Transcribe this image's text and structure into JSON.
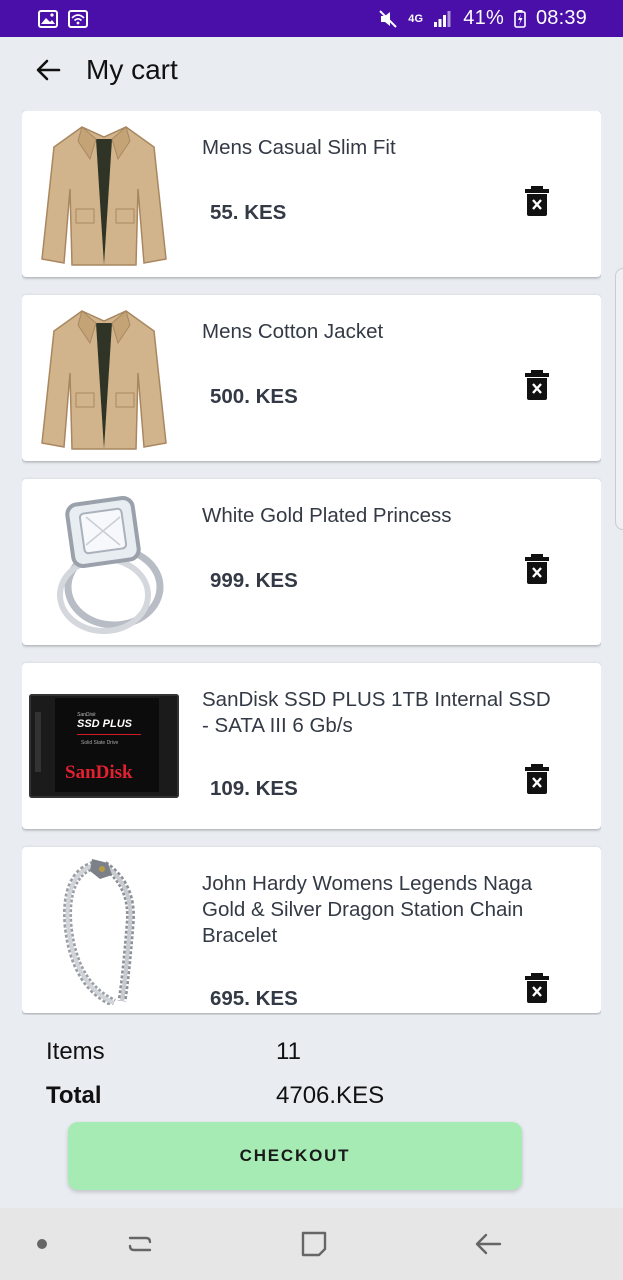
{
  "status_bar": {
    "battery": "41%",
    "time": "08:39",
    "network": "4G",
    "icons": [
      "image-icon",
      "wifi-icon",
      "mute-icon",
      "signal-icon",
      "battery-icon"
    ]
  },
  "header": {
    "title": "My cart",
    "back_icon": "arrow-left-icon"
  },
  "cart": {
    "items": [
      {
        "title": "Mens Casual Slim Fit",
        "price": "55. KES",
        "image": "jacket"
      },
      {
        "title": "Mens Cotton Jacket",
        "price": "500. KES",
        "image": "jacket"
      },
      {
        "title": "White Gold Plated Princess",
        "price": "999. KES",
        "image": "ring"
      },
      {
        "title": "SanDisk SSD PLUS 1TB Internal SSD - SATA III 6 Gb/s",
        "price": "109. KES",
        "image": "ssd"
      },
      {
        "title": "John Hardy Womens Legends Naga Gold & Silver Dragon Station Chain Bracelet",
        "price": "695. KES",
        "image": "bracelet"
      }
    ],
    "ssd_brand": "SanDisk",
    "ssd_model": "SSD PLUS",
    "ssd_sub": "Solid State Drive",
    "ssd_top": "SanDisk"
  },
  "summary": {
    "items_label": "Items",
    "items_value": "11",
    "total_label": "Total",
    "total_value": "4706.KES"
  },
  "checkout": {
    "label": "CHECKOUT"
  },
  "colors": {
    "status_bar": "#4a0fa8",
    "background": "#e9ecf1",
    "checkout": "#a6ebb3"
  }
}
